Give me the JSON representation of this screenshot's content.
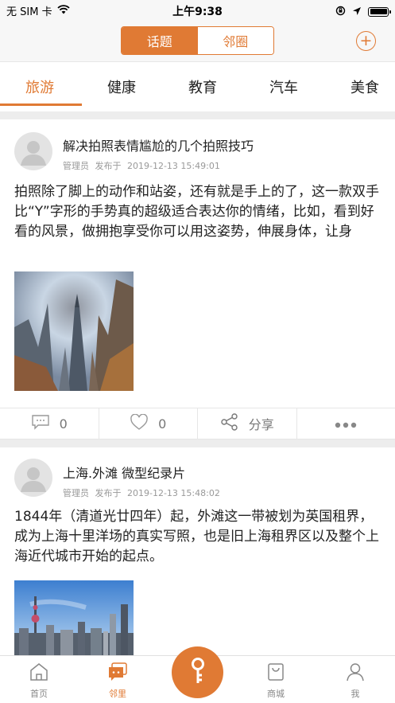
{
  "status_bar": {
    "carrier": "无 SIM 卡",
    "time": "上午9:38"
  },
  "nav": {
    "segments": [
      {
        "label": "话题",
        "active": true
      },
      {
        "label": "邻圈",
        "active": false
      }
    ],
    "add_icon": "plus-circle-icon"
  },
  "categories": [
    "旅游",
    "健康",
    "教育",
    "汽车",
    "美食"
  ],
  "posts": [
    {
      "title": "解决拍照表情尴尬的几个拍照技巧",
      "author": "管理员",
      "posted_label": "发布于",
      "datetime": "2019-12-13 15:49:01",
      "body": "拍照除了脚上的动作和站姿，还有就是手上的了，这一款双手比“Y”字形的手势真的超级适合表达你的情绪，比如，看到好看的风景，做拥抱享受你可以用这姿势，伸展身体，让身",
      "comments": "0",
      "likes": "0",
      "share_label": "分享"
    },
    {
      "title": "上海.外滩 微型纪录片",
      "author": "管理员",
      "posted_label": "发布于",
      "datetime": "2019-12-13 15:48:02",
      "body": "1844年（清道光廿四年）起，外滩这一带被划为英国租界，成为上海十里洋场的真实写照，也是旧上海租界区以及整个上海近代城市开始的起点。"
    }
  ],
  "tab_bar": {
    "tabs": [
      {
        "label": "首页",
        "icon": "home-icon",
        "active": false
      },
      {
        "label": "邻里",
        "icon": "chat-icon",
        "active": true
      },
      {
        "label": "商城",
        "icon": "shopping-bag-icon",
        "active": false
      },
      {
        "label": "我",
        "icon": "user-icon",
        "active": false
      }
    ],
    "center_icon": "key-icon"
  },
  "colors": {
    "accent": "#e07a34",
    "divider": "#ededed"
  }
}
